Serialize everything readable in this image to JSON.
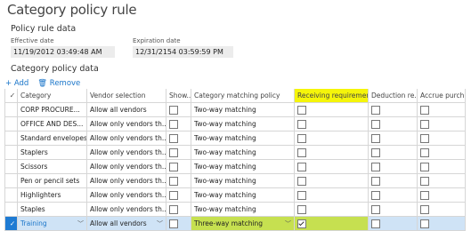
{
  "page": {
    "title": "Category policy rule"
  },
  "policy_rule": {
    "section_title": "Policy rule data",
    "effective_label": "Effective date",
    "effective_value": "11/19/2012 03:49:48 AM",
    "expiration_label": "Expiration date",
    "expiration_value": "12/31/2154 03:59:59 PM"
  },
  "category_data": {
    "section_title": "Category policy data"
  },
  "toolbar": {
    "add_label": "Add",
    "remove_label": "Remove"
  },
  "table": {
    "columns": [
      "Category",
      "Vendor selection",
      "Show...",
      "Category matching policy",
      "Receiving requirements",
      "Deduction re...",
      "Accrue purch..."
    ],
    "rows": [
      {
        "category": "CORP PROCURE...",
        "vendor": "Allow all vendors",
        "matching": "Two-way matching"
      },
      {
        "category": "OFFICE AND DES...",
        "vendor": "Allow only vendors th...",
        "matching": "Two-way matching"
      },
      {
        "category": "Standard envelopes",
        "vendor": "Allow only vendors th...",
        "matching": "Two-way matching"
      },
      {
        "category": "Staplers",
        "vendor": "Allow only vendors th...",
        "matching": "Two-way matching"
      },
      {
        "category": "Scissors",
        "vendor": "Allow only vendors th...",
        "matching": "Two-way matching"
      },
      {
        "category": "Pen or pencil sets",
        "vendor": "Allow only vendors th...",
        "matching": "Two-way matching"
      },
      {
        "category": "Highlighters",
        "vendor": "Allow only vendors th...",
        "matching": "Two-way matching"
      },
      {
        "category": "Staples",
        "vendor": "Allow only vendors th...",
        "matching": "Two-way matching"
      }
    ],
    "selected_row": {
      "category": "Training",
      "vendor": "Allow all vendors",
      "matching": "Three-way matching"
    }
  },
  "colors": {
    "accent": "#1a75c9",
    "highlight": "#f5f50a",
    "selected": "#cfe3f6"
  }
}
